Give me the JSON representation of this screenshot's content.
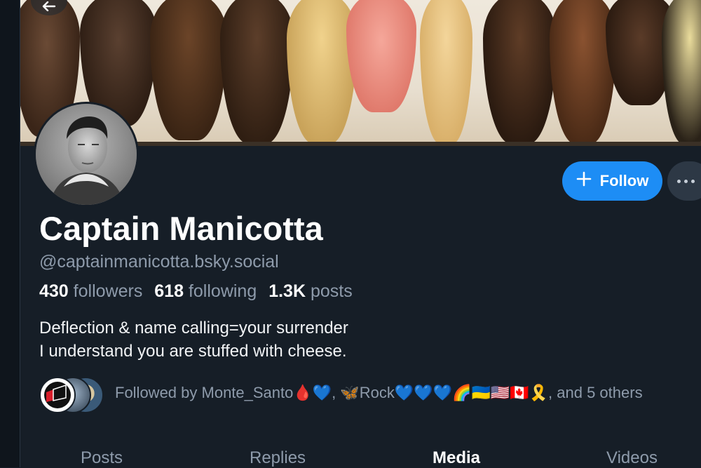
{
  "profile": {
    "display_name": "Captain Manicotta",
    "handle": "@captainmanicotta.bsky.social",
    "stats": {
      "followers_count": "430",
      "followers_label": "followers",
      "following_count": "618",
      "following_label": "following",
      "posts_count": "1.3K",
      "posts_label": "posts"
    },
    "bio": [
      "Deflection & name calling=your surrender",
      "I understand you are stuffed with cheese."
    ],
    "followed_by": "Followed by Monte_Santo🩸💙, 🦋Rock💙💙💙🌈🇺🇦🇺🇸🇨🇦🎗️, and 5 others"
  },
  "actions": {
    "follow_label": "Follow",
    "follow_icon": "plus-icon",
    "more_icon": "ellipsis-icon",
    "back_icon": "arrow-left-icon"
  },
  "tabs": [
    {
      "label": "Posts",
      "active": false
    },
    {
      "label": "Replies",
      "active": false
    },
    {
      "label": "Media",
      "active": true
    },
    {
      "label": "Videos",
      "active": false
    }
  ],
  "colors": {
    "background": "#161e27",
    "accent": "#1d8df5",
    "muted_text": "#8e9bab",
    "text": "#ffffff"
  }
}
